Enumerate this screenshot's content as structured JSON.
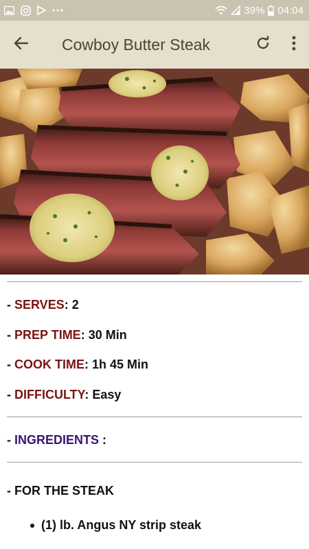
{
  "status_bar": {
    "battery": "39%",
    "time": "04:04",
    "icons": [
      "gallery-icon",
      "instagram-icon",
      "play-store-icon",
      "more-notifications-icon",
      "wifi-icon",
      "signal-icon",
      "battery-icon"
    ]
  },
  "app_bar": {
    "title": "Cowboy Butter Steak",
    "back_icon": "arrow-left-icon",
    "refresh_icon": "refresh-icon",
    "menu_icon": "overflow-menu-icon"
  },
  "recipe": {
    "serves": {
      "dash": "- ",
      "label": "SERVES",
      "sep": ": ",
      "value": "2"
    },
    "prep_time": {
      "dash": "- ",
      "label": "PREP TIME",
      "sep": ": ",
      "value": "30 Min"
    },
    "cook_time": {
      "dash": "- ",
      "label": "COOK TIME",
      "sep": ": ",
      "value": "1h 45 Min"
    },
    "difficulty": {
      "dash": "- ",
      "label": "DIFFICULTY",
      "sep": ": ",
      "value": "Easy"
    },
    "ingredients": {
      "dash": "- ",
      "label": "INGREDIENTS",
      "sep": " :"
    },
    "section_steak": "- FOR THE STEAK",
    "steak_items": [
      "(1) lb. Angus NY strip steak"
    ]
  },
  "colors": {
    "status_bar_bg": "#c9c3b0",
    "app_bar_bg": "#e5e0ce",
    "title_color": "#4a4535",
    "label_red": "#7a1414",
    "label_purple": "#3a1470"
  }
}
